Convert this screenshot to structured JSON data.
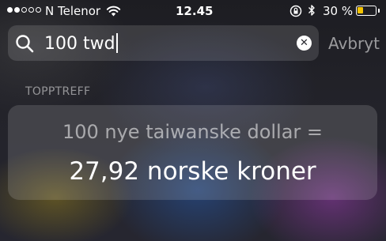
{
  "status_bar": {
    "signal_strength": 2,
    "signal_max": 5,
    "carrier": "N Telenor",
    "time": "12.45",
    "battery_percent_label": "30 %",
    "battery_level": 0.3,
    "battery_color": "#f5c400"
  },
  "search": {
    "query": "100 twd",
    "cancel_label": "Avbryt"
  },
  "results": {
    "section_title": "TOPPTREFF",
    "top_hit": {
      "query_line": "100 nye taiwanske dollar =",
      "result_line": "27,92 norske kroner"
    }
  }
}
